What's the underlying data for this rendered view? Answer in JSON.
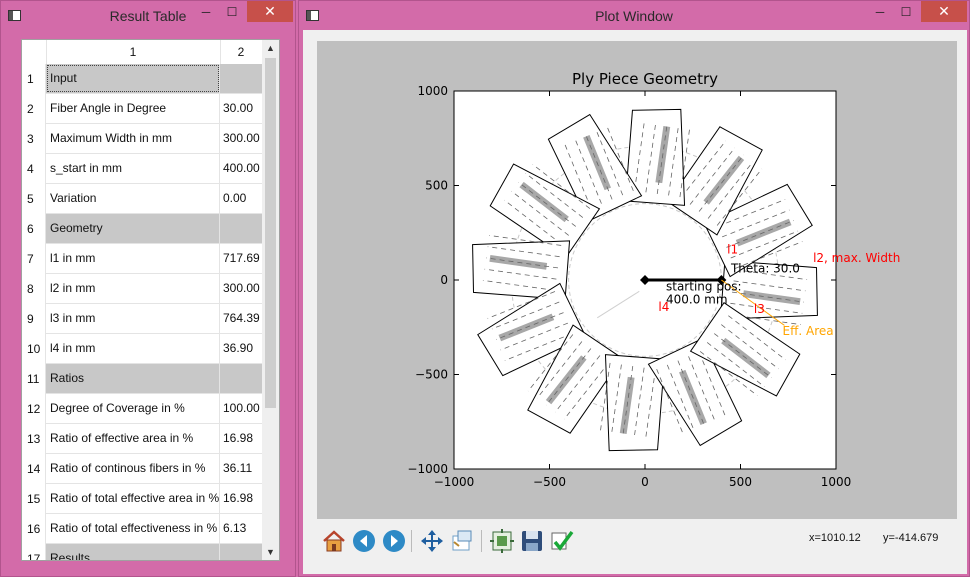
{
  "result_window": {
    "title": "Result Table",
    "col_headers": [
      "1",
      "2"
    ],
    "rows": [
      {
        "n": "1",
        "label": "Input",
        "value": "",
        "section": true
      },
      {
        "n": "2",
        "label": "Fiber Angle in Degree",
        "value": "30.00"
      },
      {
        "n": "3",
        "label": "Maximum Width in mm",
        "value": "300.00"
      },
      {
        "n": "4",
        "label": "s_start in mm",
        "value": "400.00"
      },
      {
        "n": "5",
        "label": "Variation",
        "value": "0.00"
      },
      {
        "n": "6",
        "label": "Geometry",
        "value": "",
        "section": true
      },
      {
        "n": "7",
        "label": "l1 in mm",
        "value": "717.69"
      },
      {
        "n": "8",
        "label": "l2 in mm",
        "value": "300.00"
      },
      {
        "n": "9",
        "label": "l3 in mm",
        "value": "764.39"
      },
      {
        "n": "10",
        "label": "l4 in mm",
        "value": "36.90"
      },
      {
        "n": "11",
        "label": "Ratios",
        "value": "",
        "section": true
      },
      {
        "n": "12",
        "label": "Degree of Coverage in %",
        "value": "100.00"
      },
      {
        "n": "13",
        "label": "Ratio of effective area in %",
        "value": "16.98"
      },
      {
        "n": "14",
        "label": "Ratio of continous fibers in %",
        "value": "36.11"
      },
      {
        "n": "15",
        "label": "Ratio of total effective area in %",
        "value": "16.98"
      },
      {
        "n": "16",
        "label": "Ratio of total effectiveness in %",
        "value": "6.13"
      },
      {
        "n": "17",
        "label": "Results",
        "value": "",
        "section": true
      }
    ]
  },
  "plot_window": {
    "title": "Plot Window",
    "coords_x": "x=1010.12",
    "coords_y": "y=-414.679",
    "toolbar": [
      "home-icon",
      "back-icon",
      "forward-icon",
      "pan-icon",
      "zoom-icon",
      "subplots-icon",
      "save-icon",
      "edit-axes-icon"
    ]
  },
  "chart_data": {
    "type": "scatter",
    "title": "Ply Piece Geometry",
    "xlim": [
      -1000,
      1000
    ],
    "ylim": [
      -1000,
      1000
    ],
    "x_ticks": [
      "−1000",
      "−500",
      "0",
      "500",
      "1000"
    ],
    "y_ticks": [
      "1000",
      "500",
      "0",
      "−500",
      "−1000"
    ],
    "annotations": {
      "theta": "Theta: 30.0",
      "start_line1": "starting pos:",
      "start_line2": "400.0 mm",
      "l1": "l1",
      "l2": "l2, max. Width",
      "l3": "l3",
      "l4": "l4",
      "eff": "Eff. Area"
    },
    "colors": {
      "red": "#ff0000",
      "orange": "#ffa500",
      "black": "#000000",
      "grey": "#a8a8a8"
    },
    "ply_count": 12,
    "ply_angle_step_deg": 30
  }
}
